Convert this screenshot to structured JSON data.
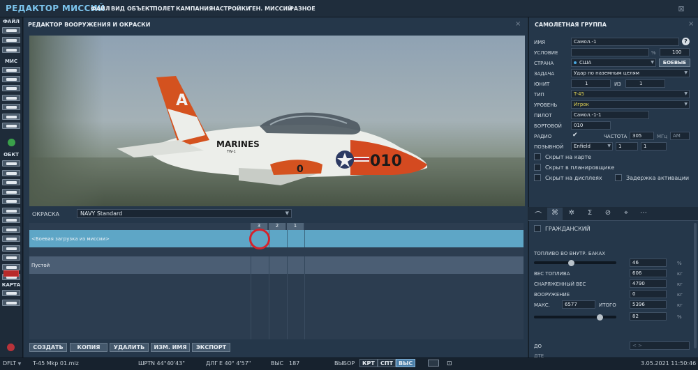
{
  "app": {
    "title": "РЕДАКТОР МИССИЙ"
  },
  "menu": [
    "ФАЙЛ",
    "ВИД",
    "ОБЪЕКТ",
    "ПОЛЕТ",
    "КАМПАНИЯ",
    "НАСТРОЙКИ",
    "ГЕН. МИССИЙ",
    "РАЗНОЕ"
  ],
  "toolbar": {
    "sections": [
      "ФАЙЛ",
      "МИС",
      "ОБКТ",
      "КАРТА"
    ]
  },
  "left_panel": {
    "title": "РЕДАКТОР ВООРУЖЕНИЯ И ОКРАСКИ",
    "close": "×",
    "aircraft_image": "T-45 Goshawk, Marines livery",
    "livery_label": "ОКРАСКА",
    "livery_value": "NAVY Standard",
    "pylons": [
      "3",
      "2",
      "1"
    ],
    "loadouts": [
      "<Боевая загрузка из миссии>",
      "Пустой"
    ],
    "buttons": [
      "СОЗДАТЬ",
      "КОПИЯ",
      "УДАЛИТЬ",
      "ИЗМ. ИМЯ",
      "ЭКСПОРТ"
    ]
  },
  "right_panel": {
    "title": "САМОЛЕТНАЯ ГРУППА",
    "close": "×",
    "name_label": "ИМЯ",
    "name_value": "Самол.-1",
    "help": "?",
    "condition_label": "УСЛОВИЕ",
    "condition_value": "",
    "percent_sign": "%",
    "condition_percent": "100",
    "country_label": "СТРАНА",
    "country_value": "США",
    "combat_button": "БОЕВЫЕ",
    "task_label": "ЗАДАЧА",
    "task_value": "Удар по наземным целям",
    "unit_label": "ЮНИТ",
    "unit_value": "1",
    "of_label": "ИЗ",
    "unit_total": "1",
    "type_label": "ТИП",
    "type_value": "T-45",
    "skill_label": "УРОВЕНЬ",
    "skill_value": "Игрок",
    "pilot_label": "ПИЛОТ",
    "pilot_value": "Самол.-1-1",
    "tail_label": "БОРТОВОЙ",
    "tail_value": "010",
    "radio_label": "РАДИО",
    "freq_label": "ЧАСТОТА",
    "freq_value": "305",
    "freq_unit": "МГц",
    "modulation": "AM",
    "callsign_label": "ПОЗЫВНОЙ",
    "callsign_value": "Enfield",
    "callsign_num1": "1",
    "callsign_num2": "1",
    "hide_map": "Скрыт на карте",
    "hide_planner": "Скрыт в планировщике",
    "hide_display": "Скрыт на дисплеях",
    "late_activation": "Задержка активации",
    "civil": "ГРАЖДАНСКИЙ",
    "fuel_label": "ТОПЛИВО ВО ВНУТР. БАКАХ",
    "fuel_percent": "46",
    "fuel_weight_label": "ВЕС ТОПЛИВА",
    "fuel_weight": "606",
    "empty_weight_label": "СНАРЯЖЕННЫЙ ВЕС",
    "empty_weight": "4790",
    "weapons_label": "ВООРУЖЕНИЕ",
    "weapons_weight": "0",
    "max_label": "МАКС.",
    "max_weight": "6577",
    "total_label": "ИТОГО",
    "total_weight": "5396",
    "load_percent": "82",
    "kg": "кг",
    "pct": "%",
    "do_label": "ДО",
    "dte_label": "ДТЕ"
  },
  "status": {
    "layer": "DFLT",
    "file": "T-45 Mkp 01.miz",
    "lat_label": "ШРТ",
    "lat": "N 44°40'43\"",
    "lon_label": "ДЛГ",
    "lon": "E 40° 4'57\"",
    "alt_label": "ВЫС",
    "alt": "187",
    "select_label": "ВЫБОР",
    "buttons": [
      "КРТ",
      "СПТ",
      "ВЫС"
    ],
    "date": "3.05.2021 11:50:46"
  }
}
